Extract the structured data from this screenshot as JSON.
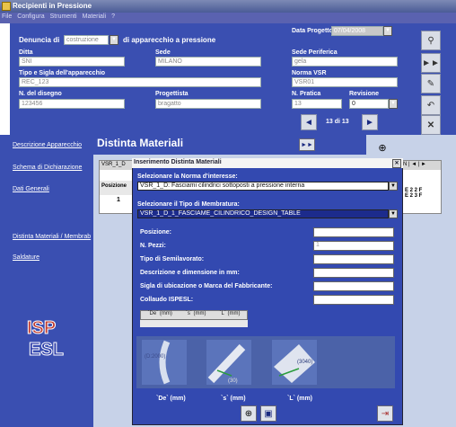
{
  "window": {
    "title": "Recipienti in Pressione"
  },
  "menu": {
    "items": [
      "File",
      "Configura",
      "Strumenti",
      "Materiali",
      "?"
    ]
  },
  "header": {
    "denuncia_label": "Denuncia di",
    "denuncia_value": "costruzione",
    "denuncia_suffix": "di apparecchio a pressione",
    "data_progetto_label": "Data Progetto:",
    "data_progetto_value": "07/04/2008",
    "ditta_label": "Ditta",
    "ditta_value": "SNI",
    "sede_label": "Sede",
    "sede_value": "MILANO",
    "sede_periferica_label": "Sede Periferica",
    "sede_periferica_value": "gela",
    "tipo_label": "Tipo e Sigla dell'apparecchio",
    "tipo_value": "REC_123",
    "norma_label": "Norma VSR",
    "norma_value": "VSR01",
    "disegno_label": "N. del disegno",
    "disegno_value": "123456",
    "progettista_label": "Progettista",
    "progettista_value": "bragatto",
    "pratica_label": "N. Pratica",
    "pratica_value": "13",
    "revisione_label": "Revisione",
    "revisione_value": "0",
    "record_counter": "13 di 13"
  },
  "nav": {
    "items": [
      "Descrizione Apparecchio",
      "Schema di Dichiarazione",
      "Dati Generali",
      "Distinta Materiali / Membrab",
      "Saldature"
    ]
  },
  "distinta": {
    "title": "Distinta Materiali",
    "tab_label": "VSR_1_D",
    "col_posizione": "Posizione",
    "row1": "1",
    "right_labels": [
      "E 2 2 F",
      "E 2 3 F"
    ]
  },
  "modal": {
    "title": "Inserimento Distinta Materiali",
    "norma_label": "Selezionare la Norma d'interesse:",
    "norma_value": "VSR_1_D: Fasciami cilindrici sottoposti a pressione interna",
    "tipo_label": "Selezionare il Tipo di Membratura:",
    "tipo_value": "VSR_1_D_1_FASCIAME_CILINDRICO_DESIGN_TABLE",
    "fields": [
      {
        "label": "Posizione:",
        "value": ""
      },
      {
        "label": "N. Pezzi:",
        "value": "1"
      },
      {
        "label": "Tipo di Semilavorato:",
        "value": ""
      },
      {
        "label": "Descrizione e dimensione in mm:",
        "value": ""
      },
      {
        "label": "Sigla di ubicazione o Marca del Fabbricante:",
        "value": ""
      },
      {
        "label": "Collaudo ISPESL:",
        "value": ""
      }
    ],
    "dim_tabs": [
      "`De` (mm)",
      "`s` (mm)",
      "`L` (mm)"
    ],
    "img_labels": [
      "(D:2000)",
      "(30)",
      "(3040)"
    ],
    "dim_labels": [
      "`De` (mm)",
      "`s` (mm)",
      "`L` (mm)"
    ]
  },
  "colors": {
    "accent": "#3a4fb1",
    "modal": "#3349b0"
  }
}
